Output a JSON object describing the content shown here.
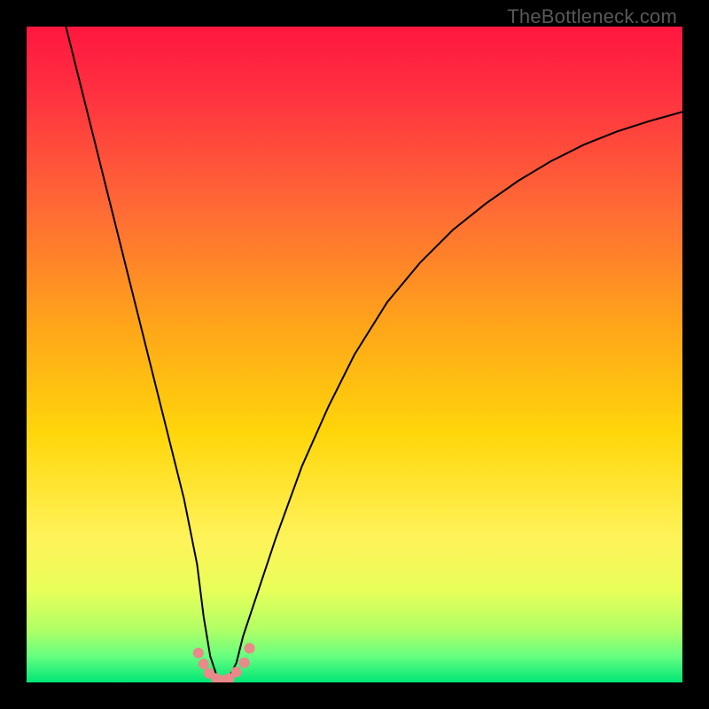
{
  "watermark": "TheBottleneck.com",
  "chart_data": {
    "type": "line",
    "title": "",
    "xlabel": "",
    "ylabel": "",
    "xlim": [
      0,
      100
    ],
    "ylim": [
      0,
      100
    ],
    "grid": false,
    "legend": false,
    "annotations": [],
    "color_stops": [
      {
        "pct": 0,
        "color": "#ff173f"
      },
      {
        "pct": 10,
        "color": "#ff3040"
      },
      {
        "pct": 28,
        "color": "#ff6b35"
      },
      {
        "pct": 45,
        "color": "#ffa31a"
      },
      {
        "pct": 62,
        "color": "#ffd60a"
      },
      {
        "pct": 78,
        "color": "#fff35a"
      },
      {
        "pct": 86,
        "color": "#e8ff5a"
      },
      {
        "pct": 92,
        "color": "#b0ff66"
      },
      {
        "pct": 96,
        "color": "#66ff80"
      },
      {
        "pct": 100,
        "color": "#00e676"
      }
    ],
    "series": [
      {
        "name": "bottleneck-curve",
        "color": "#000000",
        "width": 2,
        "x": [
          6,
          8,
          10,
          12,
          14,
          16,
          18,
          20,
          22,
          24,
          26,
          27,
          28,
          29,
          30,
          31,
          32,
          33,
          35,
          38,
          42,
          46,
          50,
          55,
          60,
          65,
          70,
          75,
          80,
          85,
          90,
          95,
          100
        ],
        "y": [
          100,
          92,
          84,
          76,
          68,
          60,
          52,
          44,
          36,
          28,
          18,
          10,
          4,
          1,
          0,
          1,
          3,
          7,
          13,
          22,
          33,
          42,
          50,
          58,
          64,
          69,
          73,
          76.5,
          79.5,
          82,
          84,
          85.6,
          87
        ]
      }
    ],
    "markers": {
      "name": "trough-points",
      "color": "#e98989",
      "radius": 6,
      "x": [
        26.2,
        27.0,
        27.8,
        28.9,
        30.0,
        30.9,
        32.0,
        33.2,
        34.0
      ],
      "y": [
        4.5,
        2.8,
        1.4,
        0.6,
        0.3,
        0.6,
        1.6,
        3.0,
        5.2
      ]
    }
  }
}
